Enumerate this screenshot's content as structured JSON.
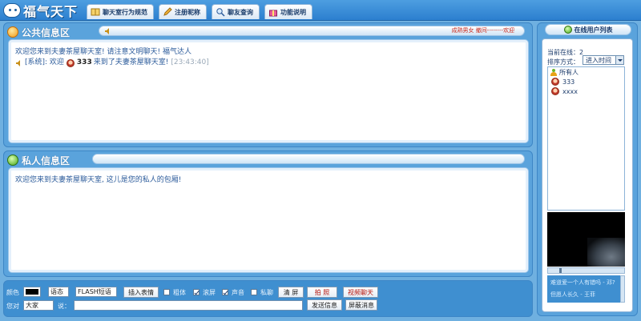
{
  "header": {
    "logo_text": "福气天下",
    "tabs": [
      {
        "label": "聊天室行为规范",
        "icon": "book-icon"
      },
      {
        "label": "注册昵称",
        "icon": "pencil-icon"
      },
      {
        "label": "聊友查询",
        "icon": "search-icon"
      },
      {
        "label": "功能说明",
        "icon": "gift-icon"
      }
    ]
  },
  "public_area": {
    "title": "公共信息区",
    "marquee": "成熟男女 撤间--------欢迎",
    "messages": [
      {
        "text": "欢迎您来到夫妻茶屋聊天室! 请注意文明聊天! 福气达人"
      },
      {
        "prefix": "[系统]: 欢迎",
        "user": "333",
        "text": "来到了夫妻茶屋聊天室!",
        "time": "[23:43:40]"
      }
    ]
  },
  "private_area": {
    "title": "私人信息区",
    "messages": [
      {
        "text": "欢迎您来到夫妻茶屋聊天室, 这儿是您的私人的包厢!"
      }
    ]
  },
  "controls": {
    "color_label": "颜色",
    "color_value": "#000000",
    "mood_value": "语态",
    "flash_value": "FLASH短语",
    "insert_emoji": "插入表情",
    "bold_label": "粗体",
    "bold_checked": false,
    "scroll_label": "滚屏",
    "scroll_checked": true,
    "sound_label": "声音",
    "sound_checked": true,
    "private_label": "私聊",
    "private_checked": false,
    "clear_label": "清 屏",
    "photo_label": "拍 照",
    "video_chat_label": "视频聊天",
    "target_label": "您对",
    "target_value": "大家",
    "say_label": "说：",
    "message_value": "",
    "send_label": "发送信息",
    "block_label": "屏蔽消息"
  },
  "sidebar": {
    "title": "在线用户列表",
    "online_label": "当前在线：",
    "online_count": "2",
    "sort_label": "排序方式：",
    "sort_value": "进入时间",
    "users": [
      {
        "name": "所有人",
        "icon": "group-icon"
      },
      {
        "name": "333",
        "icon": "avatar-icon"
      },
      {
        "name": "xxxx",
        "icon": "avatar-icon"
      }
    ],
    "notices": [
      "难道爱一个人有错吗 - 邓?",
      "但愿人长久 - 王菲"
    ]
  }
}
